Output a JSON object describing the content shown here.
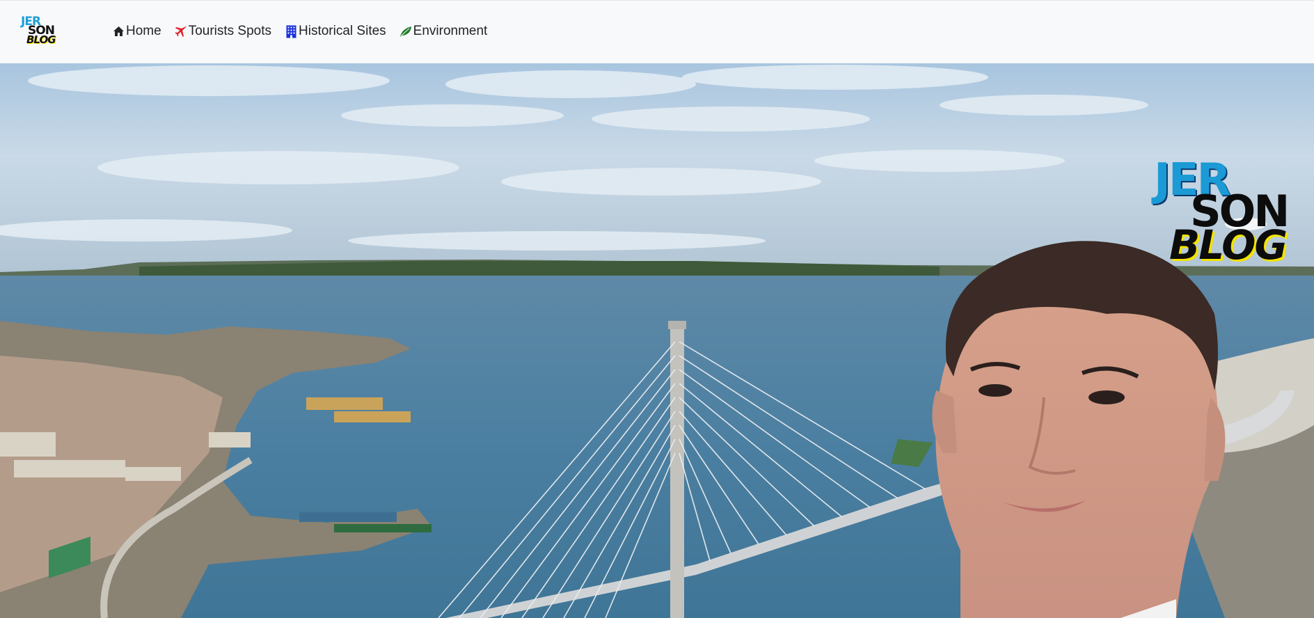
{
  "brand": {
    "logo_line1": "JER",
    "logo_line2": "SON",
    "logo_line3": "BLOG"
  },
  "nav": {
    "items": [
      {
        "label": "Home",
        "icon": "home-icon",
        "color": "#212529"
      },
      {
        "label": "Tourists Spots",
        "icon": "airplane-icon",
        "color": "#e0202a"
      },
      {
        "label": "Historical Sites",
        "icon": "building-icon",
        "color": "#1a2fe0"
      },
      {
        "label": "Environment",
        "icon": "leaf-icon",
        "color": "#1f7a2a"
      }
    ]
  },
  "hero": {
    "logo_line1": "JER",
    "logo_line2": "SON",
    "logo_line3": "BLOG"
  },
  "colors": {
    "navbar_bg": "#f8f9fa",
    "nav_text": "#212529",
    "logo_blue": "#1b9ad6",
    "logo_yellow": "#f3e300"
  }
}
